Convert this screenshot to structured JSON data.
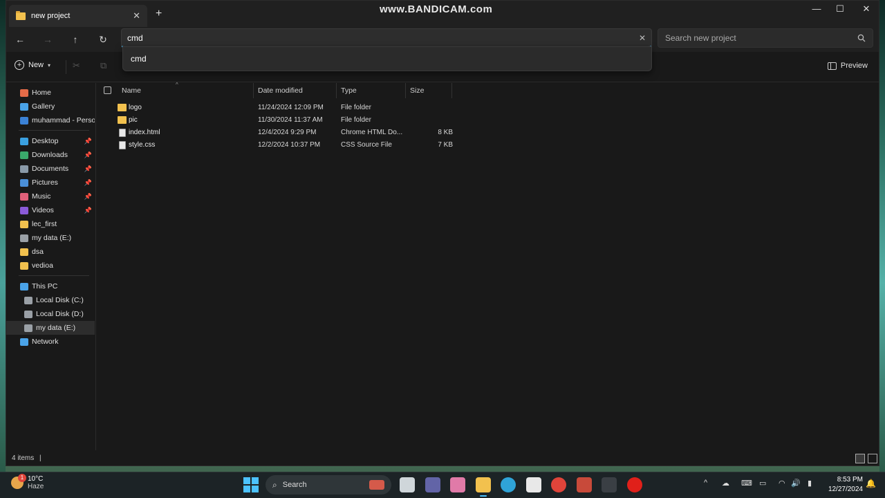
{
  "watermark": "www.BANDICAM.com",
  "tab": {
    "title": "new project",
    "close": "✕",
    "new": "+"
  },
  "window_controls": {
    "minimize": "—",
    "maximize": "☐",
    "close": "✕"
  },
  "nav": {
    "back": "←",
    "forward": "→",
    "up": "↑",
    "refresh": "↻"
  },
  "address": {
    "value": "cmd",
    "clear": "✕"
  },
  "search": {
    "placeholder": "Search new project",
    "icon": "search-icon"
  },
  "toolbar": {
    "new_label": "New",
    "cut_icon": "✂",
    "copy_icon": "⧉",
    "preview_label": "Preview"
  },
  "autocomplete": {
    "suggestion": "cmd"
  },
  "sidebar": {
    "top": [
      {
        "label": "Home",
        "icon": "home-icon",
        "color": "#e46b48"
      },
      {
        "label": "Gallery",
        "icon": "gallery-icon",
        "color": "#4aa3e8"
      },
      {
        "label": "muhammad - Person",
        "icon": "cloud-icon",
        "color": "#3b82d6"
      }
    ],
    "quick": [
      {
        "label": "Desktop",
        "icon": "desktop-icon",
        "color": "#3aa0e0",
        "pinned": "📌"
      },
      {
        "label": "Downloads",
        "icon": "download-icon",
        "color": "#3aa86b",
        "pinned": "📌"
      },
      {
        "label": "Documents",
        "icon": "documents-icon",
        "color": "#8a9aa8",
        "pinned": "📌"
      },
      {
        "label": "Pictures",
        "icon": "pictures-icon",
        "color": "#4a8fd8",
        "pinned": "📌"
      },
      {
        "label": "Music",
        "icon": "music-icon",
        "color": "#e0607a",
        "pinned": "📌"
      },
      {
        "label": "Videos",
        "icon": "videos-icon",
        "color": "#8a5ad8",
        "pinned": "📌"
      },
      {
        "label": "lec_first",
        "icon": "folder-icon",
        "color": "#f2c14e"
      },
      {
        "label": "my data (E:)",
        "icon": "drive-icon",
        "color": "#9aa0a6"
      },
      {
        "label": "dsa",
        "icon": "folder-icon",
        "color": "#f2c14e"
      },
      {
        "label": "vedioa",
        "icon": "folder-icon",
        "color": "#f2c14e"
      }
    ],
    "pc": [
      {
        "label": "This PC",
        "icon": "pc-icon",
        "color": "#4aa3e8",
        "sub": false
      },
      {
        "label": "Local Disk (C:)",
        "icon": "drive-icon",
        "color": "#9aa0a6",
        "sub": true
      },
      {
        "label": "Local Disk (D:)",
        "icon": "drive-icon",
        "color": "#9aa0a6",
        "sub": true
      },
      {
        "label": "my data (E:)",
        "icon": "drive-icon",
        "color": "#9aa0a6",
        "sub": true,
        "selected": true
      },
      {
        "label": "Network",
        "icon": "network-icon",
        "color": "#4aa3e8",
        "sub": false
      }
    ]
  },
  "columns": {
    "name": "Name",
    "date": "Date modified",
    "type": "Type",
    "size": "Size"
  },
  "files": [
    {
      "name": "logo",
      "date": "11/24/2024 12:09 PM",
      "type": "File folder",
      "size": "",
      "kind": "folder"
    },
    {
      "name": "pic",
      "date": "11/30/2024 11:37 AM",
      "type": "File folder",
      "size": "",
      "kind": "folder"
    },
    {
      "name": "index.html",
      "date": "12/4/2024 9:29 PM",
      "type": "Chrome HTML Do...",
      "size": "8 KB",
      "kind": "html"
    },
    {
      "name": "style.css",
      "date": "12/2/2024 10:37 PM",
      "type": "CSS Source File",
      "size": "7 KB",
      "kind": "css"
    }
  ],
  "status": {
    "count": "4 items",
    "cursor": "|"
  },
  "taskbar": {
    "weather": {
      "temp": "10°C",
      "condition": "Haze",
      "badge": "1"
    },
    "search_label": "Search",
    "apps": [
      {
        "name": "task-view-icon",
        "color": "#cfd6da"
      },
      {
        "name": "teams-icon",
        "color": "#6264a7"
      },
      {
        "name": "copilot-icon",
        "color": "#e07aa8"
      },
      {
        "name": "file-explorer-icon",
        "color": "#f2c14e",
        "active": true
      },
      {
        "name": "edge-icon",
        "color": "#2fa4d8"
      },
      {
        "name": "store-icon",
        "color": "#e8e8e8"
      },
      {
        "name": "chrome-icon",
        "color": "#e0443a"
      },
      {
        "name": "app-icon",
        "color": "#c84a3a"
      },
      {
        "name": "terminal-icon",
        "color": "#3a3f44"
      },
      {
        "name": "record-icon",
        "color": "#e0201a"
      }
    ],
    "tray": {
      "chevron": "^",
      "cloud": "☁",
      "keyboard": "⌨",
      "display": "▭",
      "wifi": "◠",
      "volume": "🔊",
      "battery": "▮"
    },
    "time": "8:53 PM",
    "date": "12/27/2024",
    "bell": "🔔"
  }
}
